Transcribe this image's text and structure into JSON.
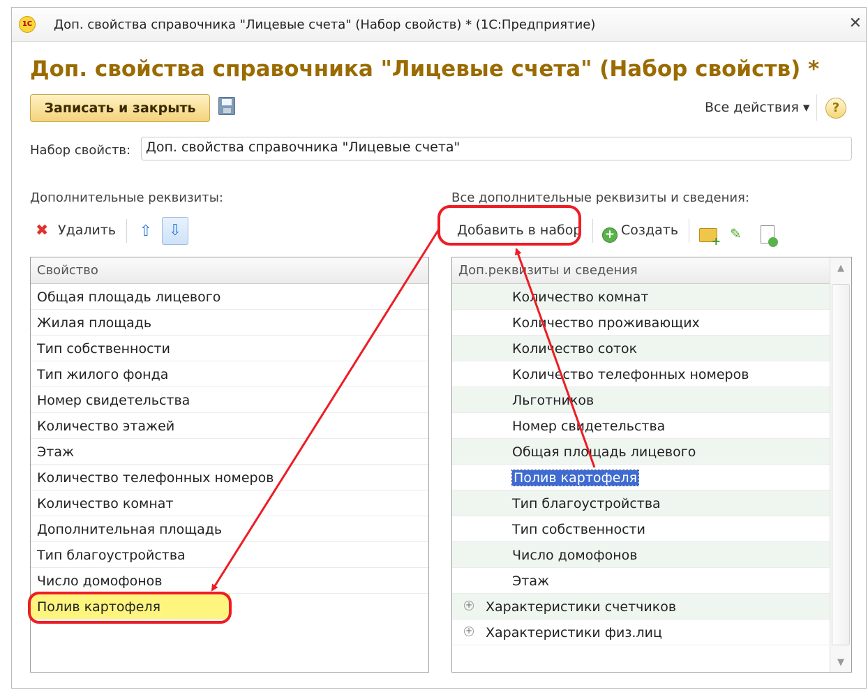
{
  "window": {
    "title": "Доп. свойства справочника \"Лицевые счета\" (Набор свойств) * (1С:Предприятие)",
    "logo_text": "1С",
    "close_glyph": "✕"
  },
  "heading": "Доп. свойства справочника \"Лицевые счета\" (Набор свойств) *",
  "toolbar": {
    "save_close_label": "Записать и закрыть",
    "all_actions_label": "Все действия ▾",
    "help_glyph": "?"
  },
  "property_set": {
    "label": "Набор свойств:",
    "value": "Доп. свойства справочника \"Лицевые счета\""
  },
  "left_panel": {
    "section_label": "Дополнительные реквизиты:",
    "delete_label": "Удалить",
    "column_header": "Свойство",
    "rows": [
      "Общая площадь лицевого",
      "Жилая площадь",
      "Тип собственности",
      "Тип жилого фонда",
      "Номер свидетельства",
      "Количество этажей",
      "Этаж",
      "Количество телефонных номеров",
      "Количество комнат",
      "Дополнительная площадь",
      "Тип благоустройства",
      "Число домофонов",
      "Полив картофеля"
    ]
  },
  "right_panel": {
    "section_label": "Все дополнительные реквизиты и сведения:",
    "add_to_set_label": "Добавить в набор",
    "create_label": "Создать",
    "column_header": "Доп.реквизиты и сведения",
    "rows": [
      "Количество комнат",
      "Количество проживающих",
      "Количество соток",
      "Количество телефонных номеров",
      "Льготников",
      "Номер свидетельства",
      "Общая площадь лицевого",
      "Полив картофеля",
      "Тип благоустройства",
      "Тип собственности",
      "Число домофонов",
      "Этаж"
    ],
    "groups": [
      "Характеристики счетчиков",
      "Характеристики физ.лиц"
    ]
  },
  "colors": {
    "heading": "#9a6b00",
    "highlight_yellow": "#fdf57e",
    "selection_blue": "#3f6bd1",
    "annotation_red": "#ee1c24",
    "row_tint": "#eff6f0"
  }
}
